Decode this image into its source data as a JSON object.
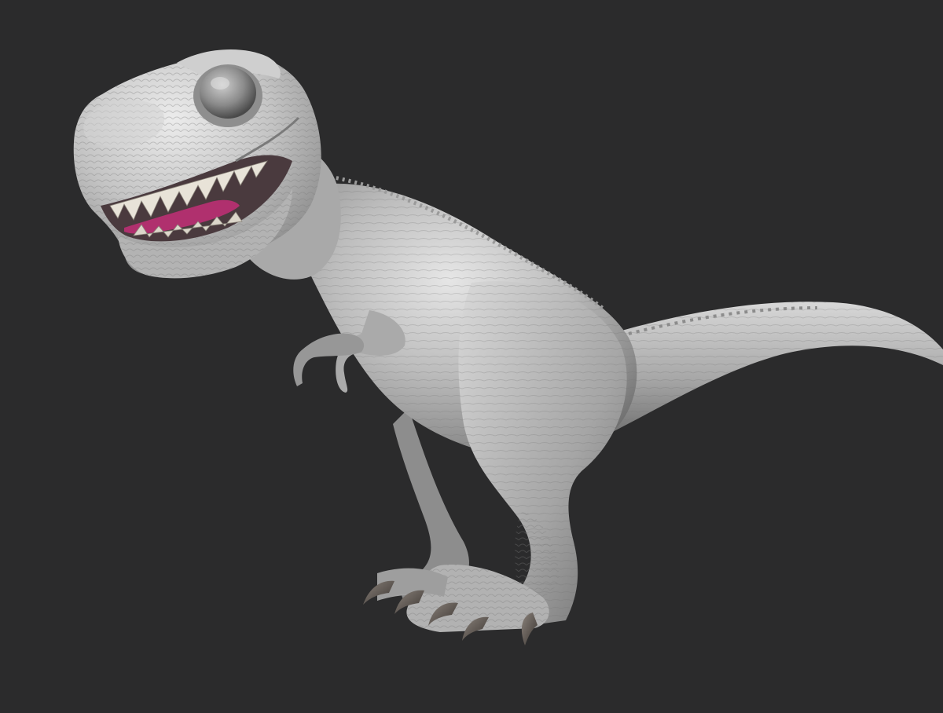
{
  "scene": {
    "subject": "trex-sculpt",
    "background_color": "#2b2b2c",
    "clay_color": "#b9b9b9",
    "clay_shadow_color": "#6f6f6f",
    "clay_highlight_color": "#eaeaea",
    "tongue_color": "#b0306e",
    "claw_color": "#5a524c",
    "eye_color": "#8f8f8f"
  }
}
